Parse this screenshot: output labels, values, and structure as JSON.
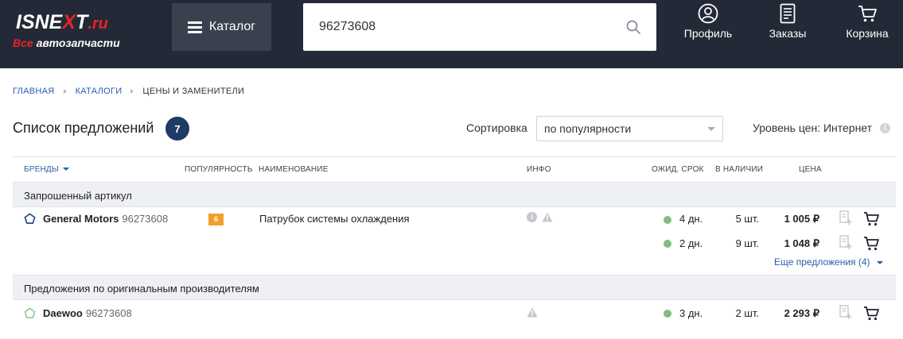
{
  "header": {
    "logo": {
      "text_main": "ISNEXT",
      "text_domain": ".ru",
      "tagline_prefix": "Все",
      "tagline_rest": "автозапчасти"
    },
    "catalog_button": "Каталог",
    "search": {
      "value": "96273608",
      "placeholder": ""
    },
    "nav": {
      "profile": "Профиль",
      "orders": "Заказы",
      "cart": "Корзина"
    }
  },
  "breadcrumb": {
    "home": "ГЛАВНАЯ",
    "catalogs": "КАТАЛОГИ",
    "current": "ЦЕНЫ И ЗАМЕНИТЕЛИ"
  },
  "offers": {
    "title": "Список предложений",
    "count": "7",
    "sort_label": "Сортировка",
    "sort_value": "по популярности",
    "price_level": "Уровень цен: Интернет"
  },
  "columns": {
    "brands": "БРЕНДЫ",
    "popularity": "ПОПУЛЯРНОСТЬ",
    "name": "НАИМЕНОВАНИЕ",
    "info": "ИНФО",
    "lead_time": "ОЖИД. СРОК",
    "in_stock": "В НАЛИЧИИ",
    "price": "ЦЕНА"
  },
  "groups": {
    "requested": "Запрошенный артикул",
    "original": "Предложения по оригинальным производителям"
  },
  "rows": {
    "gm": {
      "brand": "General Motors",
      "article": "96273608",
      "popularity": "6",
      "name": "Патрубок системы охлаждения",
      "offers": [
        {
          "days": "4 дн.",
          "stock": "5 шт.",
          "price": "1 005 ₽"
        },
        {
          "days": "2 дн.",
          "stock": "9 шт.",
          "price": "1 048 ₽"
        }
      ],
      "more": "Еще предложения (4)"
    },
    "daewoo": {
      "brand": "Daewoo",
      "article": "96273608",
      "offers": [
        {
          "days": "3 дн.",
          "stock": "2 шт.",
          "price": "2 293 ₽"
        }
      ]
    }
  },
  "colors": {
    "header_bg": "#232937",
    "accent_red": "#e8232a",
    "link_blue": "#2b5ea7",
    "badge_navy": "#1f3a64",
    "popularity_orange": "#f0a02a",
    "stock_green": "#7fbf7f"
  },
  "icons": {
    "profile": "user-circle-icon",
    "orders": "document-icon",
    "cart": "cart-icon",
    "search": "search-icon"
  }
}
